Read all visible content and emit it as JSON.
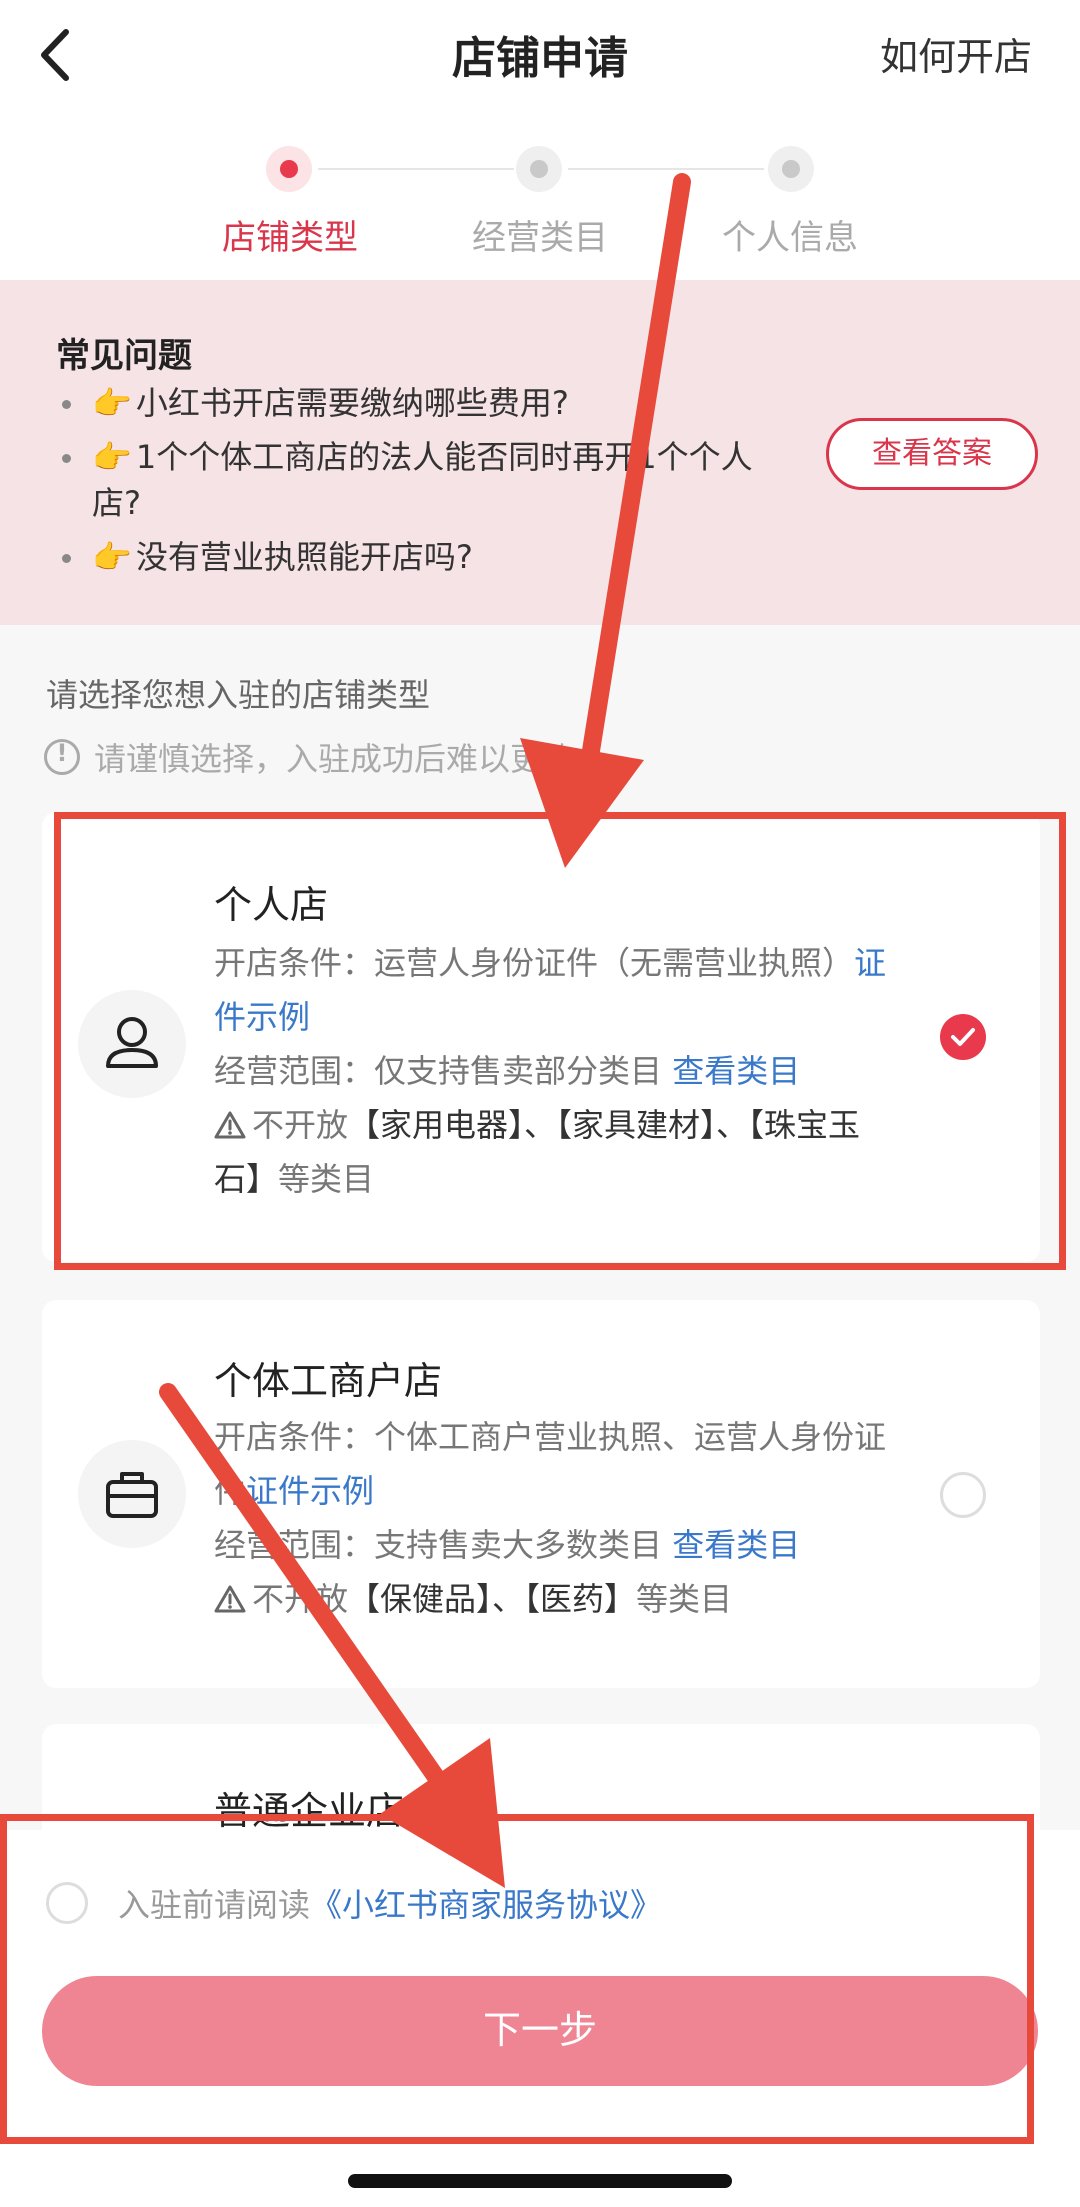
{
  "nav": {
    "title": "店铺申请",
    "how_to": "如何开店"
  },
  "steps": [
    {
      "label": "店铺类型",
      "active": true
    },
    {
      "label": "经营类目",
      "active": false
    },
    {
      "label": "个人信息",
      "active": false
    }
  ],
  "faq": {
    "title": "常见问题",
    "items": [
      "小红书开店需要缴纳哪些费用?",
      "1个个体工商店的法人能否同时再开1个个人店?",
      "没有营业执照能开店吗?"
    ],
    "hand_icon": "👉",
    "answer_button": "查看答案"
  },
  "prompt": "请选择您想入驻的店铺类型",
  "warning": "请谨慎选择，入驻成功后难以更改",
  "shops": [
    {
      "name": "个人店",
      "icon": "person-icon",
      "condition_label": "开店条件：",
      "condition": "运营人身份证件（无需营业执照）",
      "condition_link": "证件示例",
      "scope_label": "经营范围：",
      "scope": "仅支持售卖部分类目",
      "scope_link": "查看类目",
      "restriction_prefix": "不开放",
      "restriction": "【家用电器】、【家具建材】、【珠宝玉石】",
      "restriction_suffix": "等类目",
      "selected": true
    },
    {
      "name": "个体工商户店",
      "icon": "briefcase-icon",
      "condition_label": "开店条件：",
      "condition": "个体工商户营业执照、运营人身份证件",
      "condition_link": "证件示例",
      "scope_label": "经营范围：",
      "scope": "支持售卖大多数类目",
      "scope_link": "查看类目",
      "restriction_prefix": "不开放",
      "restriction": "【保健品】、【医药】",
      "restriction_suffix": "等类目",
      "selected": false
    },
    {
      "name": "普通企业店"
    }
  ],
  "agreement": {
    "prefix": "入驻前请阅读",
    "link": "《小红书商家服务协议》"
  },
  "next_button": "下一步",
  "colors": {
    "accent": "#e8394d",
    "link": "#3a78c9",
    "annotation": "#e74a3b",
    "button": "#ef8593"
  }
}
